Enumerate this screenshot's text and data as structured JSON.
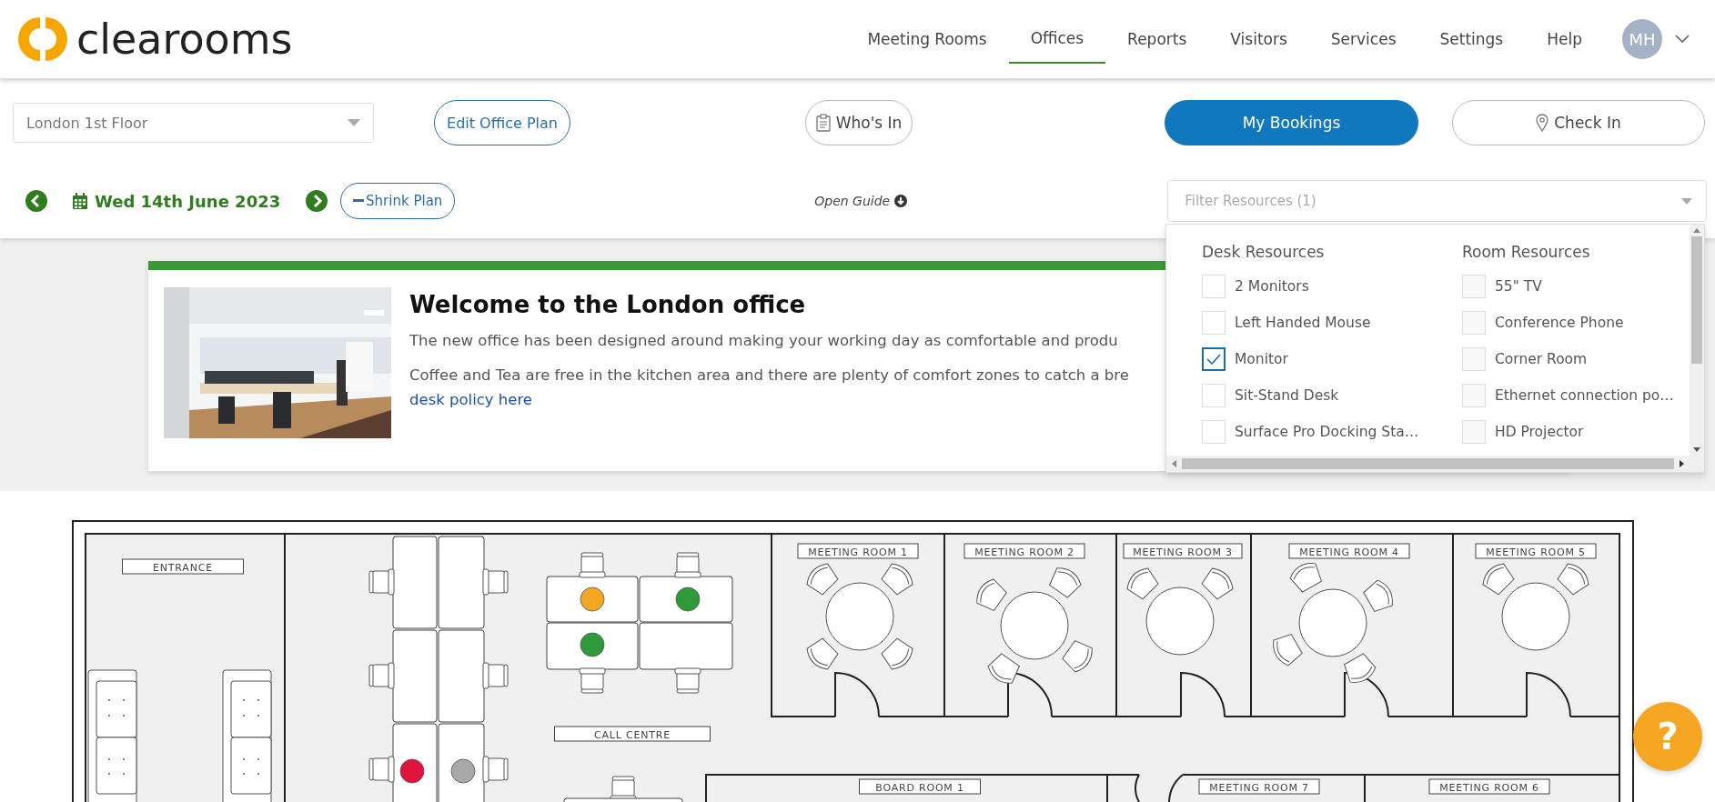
{
  "header": {
    "logo": "clearooms",
    "nav": [
      {
        "label": "Meeting Rooms",
        "selected": false
      },
      {
        "label": "Offices",
        "selected": true
      },
      {
        "label": "Reports",
        "selected": false
      },
      {
        "label": "Visitors",
        "selected": false
      },
      {
        "label": "Services",
        "selected": false
      },
      {
        "label": "Settings",
        "selected": false
      },
      {
        "label": "Help",
        "selected": false
      }
    ],
    "avatar": "MH"
  },
  "toolbar": {
    "location": {
      "value": "London 1st Floor"
    },
    "edit_plan": "Edit Office Plan",
    "whos_in": "Who's In",
    "my_bookings": "My Bookings",
    "check_in": "Check In",
    "date": "Wed 14th June 2023",
    "shrink_plan": "Shrink Plan",
    "open_guide": "Open Guide",
    "filter": {
      "placeholder": "Filter Resources (1)"
    }
  },
  "filter_dropdown": {
    "groups": [
      {
        "title": "Desk Resources",
        "items": [
          {
            "label": "2 Monitors",
            "checked": false
          },
          {
            "label": "Left Handed Mouse",
            "checked": false
          },
          {
            "label": "Monitor",
            "checked": true
          },
          {
            "label": "Sit-Stand Desk",
            "checked": false
          },
          {
            "label": "Surface Pro Docking Sta…",
            "checked": false
          }
        ]
      },
      {
        "title": "Room Resources",
        "items": [
          {
            "label": "55\" TV",
            "checked": false
          },
          {
            "label": "Conference Phone",
            "checked": false
          },
          {
            "label": "Corner Room",
            "checked": false
          },
          {
            "label": "Ethernet connection po…",
            "checked": false
          },
          {
            "label": "HD Projector",
            "checked": false
          }
        ]
      }
    ]
  },
  "welcome": {
    "title": "Welcome to the London office",
    "paragraphs": [
      "The new office has been designed around making your working day as comfortable and produ",
      "Coffee and Tea are free in the kitchen area and there are plenty of comfort zones to catch a bre"
    ],
    "link": "desk policy here"
  },
  "plan": {
    "labels": [
      "ENTRANCE",
      "CALL CENTRE",
      "MEETING ROOM 1",
      "MEETING ROOM 2",
      "MEETING ROOM 3",
      "MEETING ROOM 4",
      "MEETING ROOM 5",
      "BOARD ROOM 1",
      "MEETING ROOM 7",
      "MEETING ROOM 6"
    ],
    "desk_markers": [
      {
        "color": "#f5a623"
      },
      {
        "color": "#2e9a3a"
      },
      {
        "color": "#2e9a3a"
      },
      {
        "color": "#e0143c"
      },
      {
        "color": "#a8a8a8"
      }
    ]
  },
  "help_button": "?"
}
